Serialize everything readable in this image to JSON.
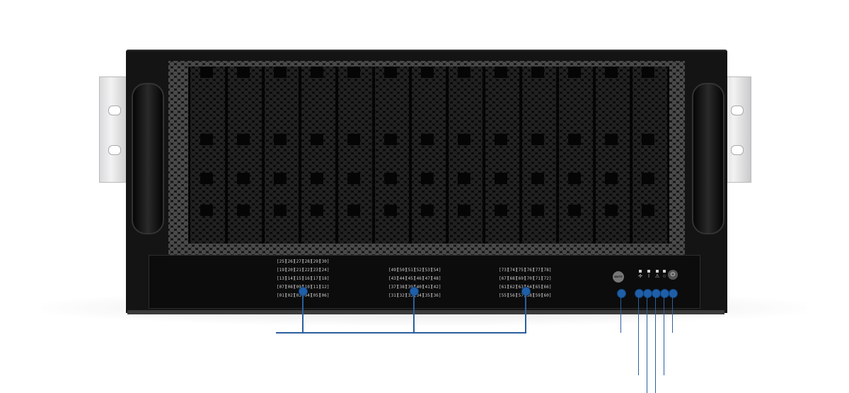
{
  "bay_numbers": {
    "group_left": [
      [
        "25",
        "26",
        "27",
        "28",
        "29",
        "30"
      ],
      [
        "19",
        "20",
        "21",
        "22",
        "23",
        "24"
      ],
      [
        "13",
        "14",
        "15",
        "16",
        "17",
        "18"
      ],
      [
        "07",
        "08",
        "09",
        "10",
        "11",
        "12"
      ],
      [
        "01",
        "02",
        "03",
        "04",
        "05",
        "06"
      ]
    ],
    "group_middle": [
      [
        "49",
        "50",
        "51",
        "52",
        "53",
        "54"
      ],
      [
        "43",
        "44",
        "45",
        "46",
        "47",
        "48"
      ],
      [
        "37",
        "38",
        "39",
        "40",
        "41",
        "42"
      ],
      [
        "31",
        "32",
        "33",
        "34",
        "35",
        "36"
      ]
    ],
    "group_right": [
      [
        "73",
        "74",
        "75",
        "76",
        "77",
        "78"
      ],
      [
        "67",
        "68",
        "69",
        "70",
        "71",
        "72"
      ],
      [
        "61",
        "62",
        "63",
        "64",
        "65",
        "66"
      ],
      [
        "55",
        "56",
        "57",
        "58",
        "59",
        "60"
      ]
    ]
  },
  "controls": {
    "mute_label": "MUTE",
    "power_symbol": "⏻",
    "indicators": [
      "fan-indicator",
      "temperature-indicator",
      "warning-indicator",
      "power-status-indicator"
    ]
  },
  "colors": {
    "callout": "#2a5f9e",
    "chassis": "#141414"
  }
}
